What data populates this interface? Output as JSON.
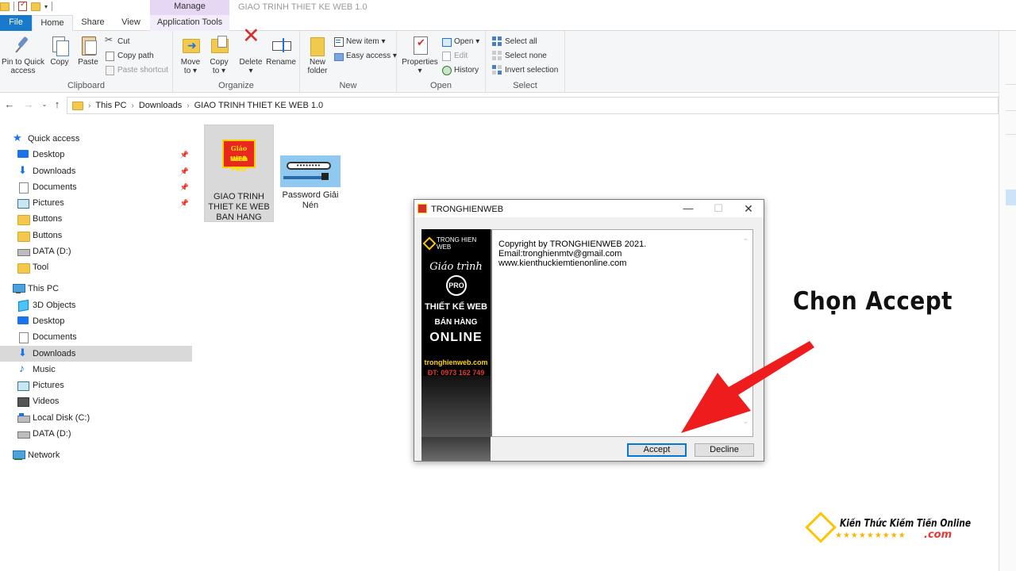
{
  "window": {
    "title": "GIAO TRINH THIET KE WEB 1.0",
    "manage_label": "Manage"
  },
  "ribbon_tabs": {
    "file": "File",
    "home": "Home",
    "share": "Share",
    "view": "View",
    "app_tools": "Application Tools"
  },
  "clipboard": {
    "pin_label": "Pin to Quick\naccess",
    "pin_l1": "Pin to Quick",
    "pin_l2": "access",
    "copy": "Copy",
    "paste": "Paste",
    "cut": "Cut",
    "copy_path": "Copy path",
    "paste_shortcut": "Paste shortcut",
    "group": "Clipboard"
  },
  "organize": {
    "move_l1": "Move",
    "move_l2": "to ▾",
    "copy_l1": "Copy",
    "copy_l2": "to ▾",
    "delete_l1": "Delete",
    "delete_l2": "▾",
    "rename": "Rename",
    "group": "Organize"
  },
  "new": {
    "folder_l1": "New",
    "folder_l2": "folder",
    "new_item": "New item ▾",
    "easy_access": "Easy access ▾",
    "group": "New"
  },
  "open": {
    "properties_l1": "Properties",
    "properties_l2": "▾",
    "open": "Open ▾",
    "edit": "Edit",
    "history": "History",
    "group": "Open"
  },
  "select": {
    "select_all": "Select all",
    "select_none": "Select none",
    "invert": "Invert selection",
    "group": "Select"
  },
  "nav": {
    "back_icon": "back-arrow-icon",
    "crumbs": [
      "This PC",
      "Downloads",
      "GIAO TRINH THIET KE WEB 1.0"
    ]
  },
  "sidebar": {
    "quick_access": "Quick access",
    "qa_items": [
      "Desktop",
      "Downloads",
      "Documents",
      "Pictures",
      "Buttons",
      "Buttons",
      "DATA (D:)",
      "Tool"
    ],
    "this_pc": "This PC",
    "pc_items": [
      "3D Objects",
      "Desktop",
      "Documents",
      "Downloads",
      "Music",
      "Pictures",
      "Videos",
      "Local Disk (C:)",
      "DATA (D:)"
    ],
    "network": "Network"
  },
  "files": [
    {
      "l1": "GIAO TRINH",
      "l2": "THIET KE WEB",
      "l3": "BAN HANG",
      "thumb_t1": "Giáo trình",
      "thumb_t2": "WEB PRO"
    },
    {
      "l1": "Password Giải",
      "l2": "Nén",
      "thumb_pw": "••••••••"
    }
  ],
  "dialog": {
    "title": "TRONGHIENWEB",
    "banner": {
      "logo": "TRONG HIEN WEB",
      "script": "Giáo trình",
      "pro": "PRO",
      "t1": "THIẾT KẾ WEB",
      "t2": "BÁN HÀNG",
      "t3": "ONLINE",
      "url": "tronghienweb.com",
      "phone": "ĐT: 0973 162 749"
    },
    "lines": [
      "Copyright by TRONGHIENWEB 2021.",
      "Email:tronghienmtv@gmail.com",
      "www.kienthuckiemtienonline.com"
    ],
    "accept": "Accept",
    "decline": "Decline"
  },
  "annotation": {
    "text": "Chọn Accept",
    "arrow_color": "#ee1c1c"
  },
  "watermark": {
    "title": "Kiến Thức Kiếm Tiền Online",
    "stars": "★★★★★★★★★",
    "suffix": ".com"
  },
  "colors": {
    "file_tab": "#1979ca",
    "manage_bg": "#e6d7f5",
    "selected_bg": "#d9d9d9",
    "accent": "#0078d7"
  }
}
